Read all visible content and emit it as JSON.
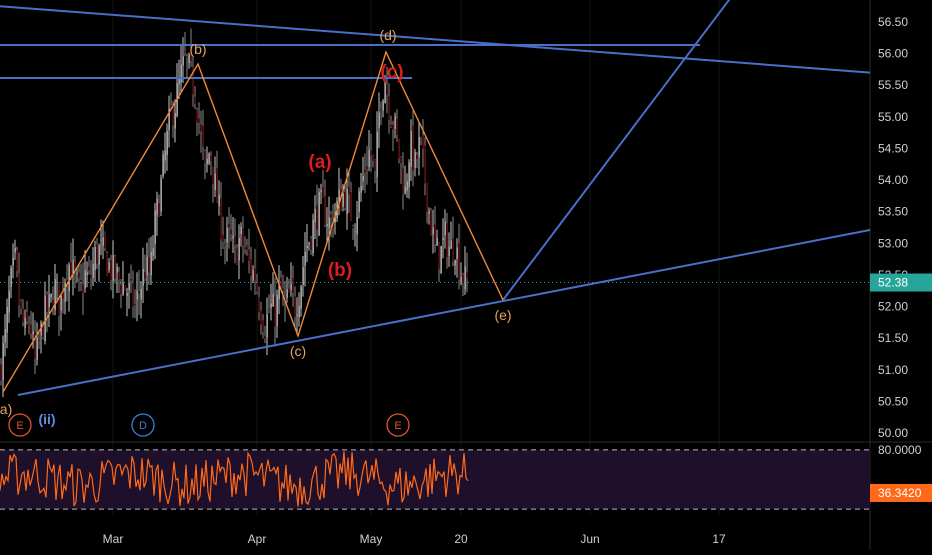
{
  "chart_data": {
    "type": "candlestick",
    "main_panel": {
      "y_ticks": [
        56.5,
        56.0,
        55.5,
        55.0,
        54.5,
        54.0,
        53.5,
        53.0,
        52.5,
        52.0,
        51.5,
        51.0,
        50.5,
        50.0
      ],
      "y_tick_labels": [
        "56.50",
        "56.00",
        "55.50",
        "55.00",
        "54.50",
        "54.00",
        "53.50",
        "53.00",
        "52.50",
        "52.00",
        "51.50",
        "51.00",
        "50.50",
        "50.00"
      ],
      "ylim": [
        49.9,
        56.8
      ],
      "last_price": 52.38,
      "last_price_label": "52.38",
      "price_path": [
        [
          0,
          51.0
        ],
        [
          5,
          51.5
        ],
        [
          10,
          52.3
        ],
        [
          15,
          52.7
        ],
        [
          20,
          51.9
        ],
        [
          25,
          51.6
        ],
        [
          30,
          51.8
        ],
        [
          35,
          51.1
        ],
        [
          40,
          51.5
        ],
        [
          45,
          51.9
        ],
        [
          50,
          52.0
        ],
        [
          55,
          52.3
        ],
        [
          60,
          52.0
        ],
        [
          65,
          52.5
        ],
        [
          70,
          52.7
        ],
        [
          75,
          52.4
        ],
        [
          80,
          52.2
        ],
        [
          85,
          52.5
        ],
        [
          90,
          52.4
        ],
        [
          95,
          52.8
        ],
        [
          100,
          52.9
        ],
        [
          105,
          52.8
        ],
        [
          110,
          52.6
        ],
        [
          115,
          52.5
        ],
        [
          120,
          52.4
        ],
        [
          125,
          52.3
        ],
        [
          130,
          52.2
        ],
        [
          135,
          52.0
        ],
        [
          140,
          52.3
        ],
        [
          145,
          52.6
        ],
        [
          150,
          52.5
        ],
        [
          155,
          53.3
        ],
        [
          160,
          53.8
        ],
        [
          165,
          54.4
        ],
        [
          170,
          55.0
        ],
        [
          175,
          55.2
        ],
        [
          180,
          55.6
        ],
        [
          185,
          55.9
        ],
        [
          190,
          55.7
        ],
        [
          195,
          55.4
        ],
        [
          200,
          54.8
        ],
        [
          205,
          54.1
        ],
        [
          210,
          54.5
        ],
        [
          215,
          53.9
        ],
        [
          220,
          53.4
        ],
        [
          225,
          53.0
        ],
        [
          230,
          53.1
        ],
        [
          235,
          52.8
        ],
        [
          240,
          53.1
        ],
        [
          245,
          52.9
        ],
        [
          250,
          52.6
        ],
        [
          255,
          52.5
        ],
        [
          260,
          52.0
        ],
        [
          265,
          51.7
        ],
        [
          270,
          52.0
        ],
        [
          275,
          51.9
        ],
        [
          280,
          52.3
        ],
        [
          285,
          52.0
        ],
        [
          290,
          52.2
        ],
        [
          295,
          52.0
        ],
        [
          300,
          52.3
        ],
        [
          305,
          52.9
        ],
        [
          310,
          53.1
        ],
        [
          315,
          53.4
        ],
        [
          320,
          53.6
        ],
        [
          325,
          53.5
        ],
        [
          330,
          53.3
        ],
        [
          335,
          53.5
        ],
        [
          340,
          53.7
        ],
        [
          345,
          53.8
        ],
        [
          350,
          53.5
        ],
        [
          355,
          53.4
        ],
        [
          360,
          53.8
        ],
        [
          365,
          54.2
        ],
        [
          370,
          54.5
        ],
        [
          375,
          54.0
        ],
        [
          380,
          55.3
        ],
        [
          385,
          55.6
        ],
        [
          390,
          55.1
        ],
        [
          395,
          54.8
        ],
        [
          400,
          54.3
        ],
        [
          405,
          53.8
        ],
        [
          410,
          54.6
        ],
        [
          415,
          54.2
        ],
        [
          420,
          54.6
        ],
        [
          425,
          54.0
        ],
        [
          430,
          53.4
        ],
        [
          435,
          52.9
        ],
        [
          440,
          52.8
        ],
        [
          445,
          53.1
        ],
        [
          450,
          52.9
        ],
        [
          455,
          53.0
        ],
        [
          460,
          52.6
        ],
        [
          465,
          52.4
        ],
        [
          468,
          52.38
        ]
      ],
      "elliott_waves": [
        {
          "label": "a)",
          "price": 50.5,
          "x": 3
        },
        {
          "label": "(b)",
          "price": 55.9,
          "x": 198
        },
        {
          "label": "(c)",
          "price": 51.5,
          "x": 298
        },
        {
          "label": "(d)",
          "price": 56.1,
          "x": 386
        },
        {
          "label": "(e)",
          "price": 52.1,
          "x": 503
        }
      ],
      "abc_labels": [
        {
          "label": "(a)",
          "x": 320,
          "price": 54.3
        },
        {
          "label": "(b)",
          "x": 340,
          "price": 52.55
        },
        {
          "label": "(c)",
          "x": 392,
          "price": 55.7
        }
      ],
      "cycle_labels": [
        {
          "label": "(ii)",
          "x": 47
        }
      ],
      "markers": [
        {
          "label": "E",
          "x": 20,
          "color": "#e0552f"
        },
        {
          "label": "D",
          "x": 143,
          "color": "#3d7fd6"
        },
        {
          "label": "E",
          "x": 398,
          "color": "#e0552f"
        }
      ]
    },
    "oscillator_panel": {
      "upper_level": 80,
      "upper_label": "80.0000",
      "last_value": 36.342,
      "last_label": "36.3420",
      "ylim": [
        14,
        86
      ]
    },
    "x_tick_labels": [
      {
        "label": "Mar",
        "x": 113
      },
      {
        "label": "Apr",
        "x": 257
      },
      {
        "label": "May",
        "x": 371
      },
      {
        "label": "20",
        "x": 461
      },
      {
        "label": "Jun",
        "x": 590
      },
      {
        "label": "17",
        "x": 719
      }
    ]
  },
  "colors": {
    "background": "#000000",
    "wave_line": "#f08a3a",
    "wave_label": "#e8a45a",
    "trend_line": "#4a6fc9",
    "abc_label": "#d81e1e",
    "price_line": "#26a69a",
    "oscillator": "#ff6a1a",
    "oscillator_band": "#1e0f2a"
  }
}
